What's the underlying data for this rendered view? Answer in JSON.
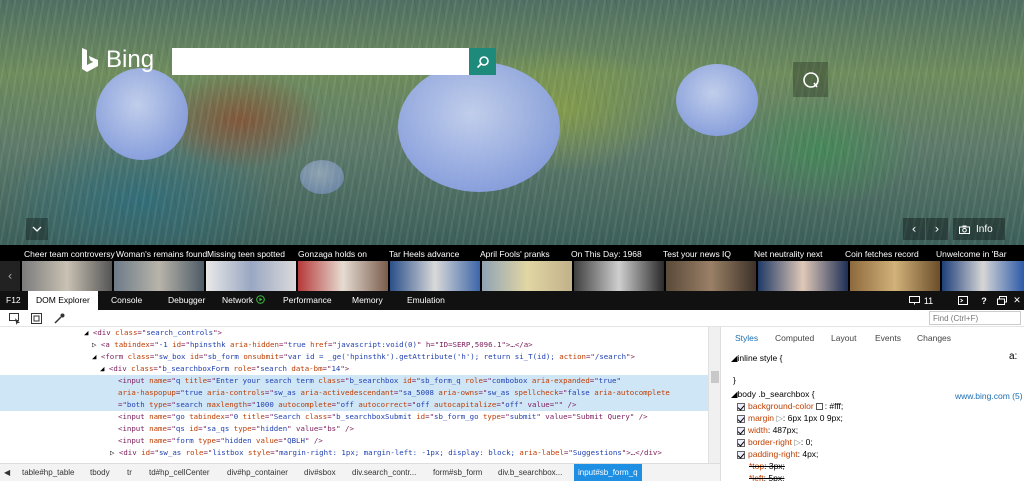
{
  "page": {
    "logo": "Bing",
    "search_value": "",
    "info_label": "Info"
  },
  "news": [
    "Cheer team controversy",
    "Woman's remains found",
    "Missing teen spotted",
    "Gonzaga holds on",
    "Tar Heels advance",
    "April Fools' pranks",
    "On This Day: 1968",
    "Test your news IQ",
    "Net neutrality next",
    "Coin fetches record",
    "Unwelcome in 'Bar"
  ],
  "devtools": {
    "f12": "F12",
    "tabs": [
      "DOM Explorer",
      "Console",
      "Debugger",
      "Network",
      "Performance",
      "Memory",
      "Emulation"
    ],
    "target_count": "11",
    "help_glyph": "?",
    "find_placeholder": "Find (Ctrl+F)"
  },
  "dom": [
    [
      "<div ",
      "class",
      "=\"",
      "search_controls",
      "\">"
    ],
    [
      "<a ",
      "tabindex",
      "=\"",
      "-1",
      " id",
      "=\"",
      "hpinsthk",
      " aria-hidden",
      "=\"",
      "true",
      " href",
      "=\"",
      "javascript:void(0)",
      "\" h=\"ID=SERP,5096.1\">…</a>"
    ],
    [
      "<form ",
      "class",
      "=\"",
      "sw_box",
      " id",
      "=\"",
      "sb_form",
      " onsubmit",
      "=\"",
      "var id = _ge('hpinsthk').getAttribute('h'); return si_T(id);",
      " action",
      "=\"",
      "/search",
      "\">"
    ],
    [
      "<div ",
      "class",
      "=\"",
      "b_searchboxForm",
      " role",
      "=\"",
      "search",
      " data-bm",
      "=\"",
      "14",
      "\">"
    ],
    [
      "<input ",
      "name",
      "=\"",
      "q",
      " title",
      "=\"",
      "Enter your search term",
      " class",
      "=\"",
      "b_searchbox",
      " id",
      "=\"",
      "sb_form_q",
      " role",
      "=\"",
      "combobox",
      " aria-expanded",
      "=\"",
      "true",
      "",
      "",
      "\""
    ],
    [
      "aria-haspopup",
      "=\"",
      "true",
      " aria-controls",
      "=\"",
      "sw_as",
      " aria-activedescendant",
      "=\"",
      "sa_5008",
      " aria-owns",
      "=\"",
      "sw_as",
      " spellcheck",
      "=\"",
      "false",
      " aria-autocomplete"
    ],
    [
      "=\"",
      "both",
      " type",
      "=\"",
      "search",
      " maxlength",
      "=\"",
      "1000",
      " autocomplete",
      "=\"",
      "off",
      " autocorrect",
      "=\"",
      "off",
      " autocapitalize",
      "=\"",
      "off",
      "\" value=\"\" />"
    ],
    [
      "<input ",
      "name",
      "=\"",
      "go",
      " tabindex",
      "=\"",
      "0",
      " title",
      "=\"",
      "Search",
      " class",
      "=\"",
      "b_searchboxSubmit",
      " id",
      "=\"",
      "sb_form_go",
      " type",
      "=\"",
      "submit",
      "\" value=\"Submit Query\" />"
    ],
    [
      "<input ",
      "name",
      "=\"",
      "qs",
      " id",
      "=\"",
      "sa_qs",
      " type",
      "=\"",
      "hidden",
      "\" value=\"bs\" />"
    ],
    [
      "<input ",
      "name",
      "=\"",
      "form",
      " type",
      "=\"",
      "hidden",
      " value",
      "=\"",
      "QBLH",
      "\" />"
    ],
    [
      "<div ",
      "id",
      "=\"",
      "sw_as",
      " role",
      "=\"",
      "listbox",
      " style",
      "=\"",
      "margin-right: 1px; margin-left: -1px; display: block;",
      " aria-label",
      "=\"",
      "Suggestions",
      "\">…</div>"
    ]
  ],
  "styles": {
    "tabs": [
      "Styles",
      "Computed",
      "Layout",
      "Events",
      "Changes"
    ],
    "inline_label": "inline style  {",
    "add_rule_glyph": "a:",
    "close_brace": "}",
    "rule_selector": "body .b_searchbox  {",
    "rule_source": "www.bing.com (5)",
    "props": [
      {
        "name": "background-color",
        "value": ": #fff;"
      },
      {
        "name": "margin",
        "value": ": 6px 1px 0 9px;"
      },
      {
        "name": "width",
        "value": ": 487px;"
      },
      {
        "name": "border-right",
        "value": ": 0;"
      },
      {
        "name": "padding-right",
        "value": ": 4px;"
      },
      {
        "name": "*top",
        "value": ": 3px;"
      },
      {
        "name": "*left",
        "value": ": 5px;"
      }
    ]
  },
  "breadcrumbs": [
    "table#hp_table",
    "tbody",
    "tr",
    "td#hp_cellCenter",
    "div#hp_container",
    "div#sbox",
    "div.search_contr...",
    "form#sb_form",
    "div.b_searchbox...",
    "input#sb_form_q"
  ]
}
